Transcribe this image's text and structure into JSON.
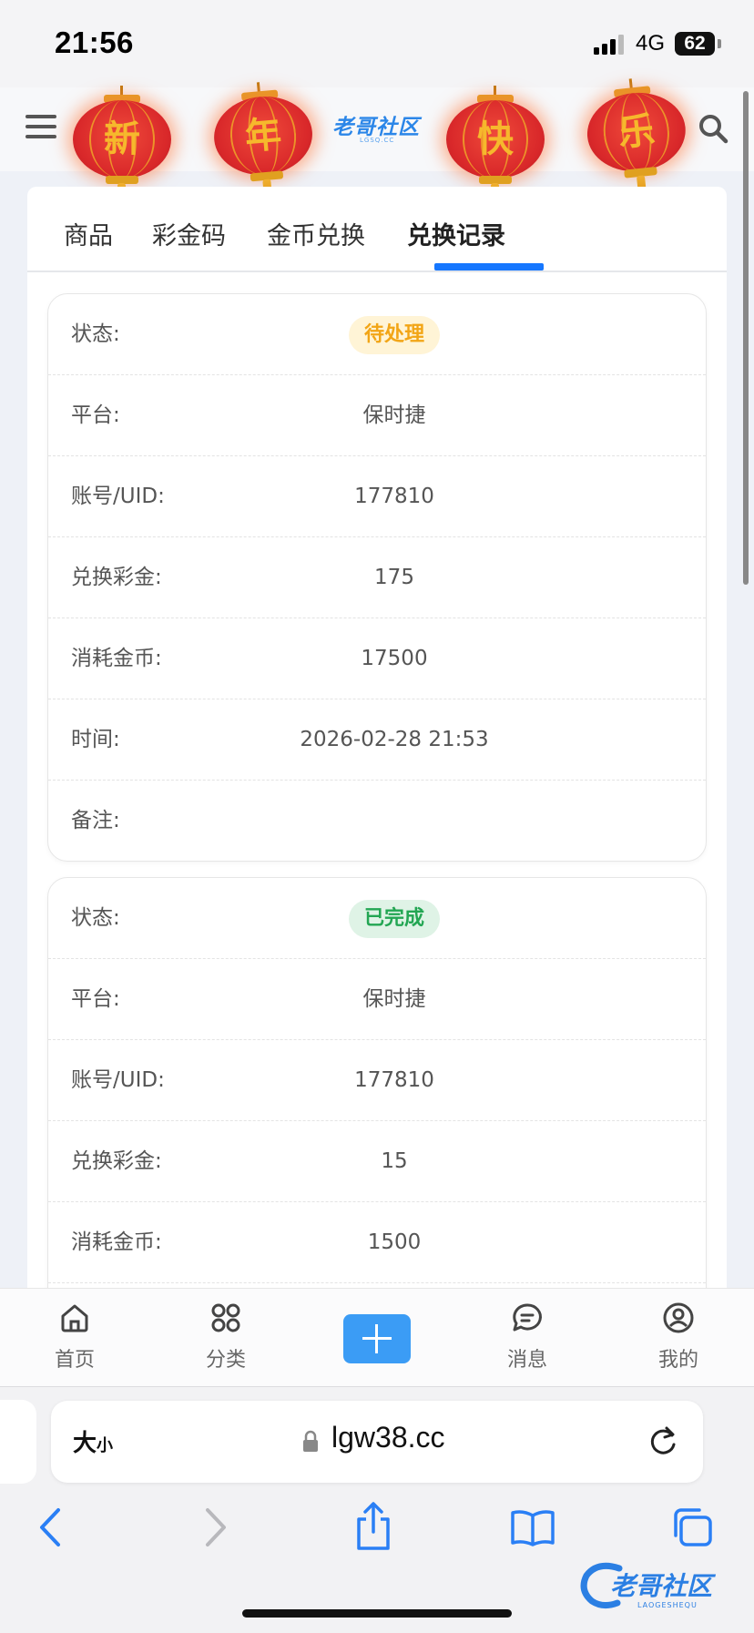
{
  "status_bar": {
    "time": "21:56",
    "network": "4G",
    "battery": "62"
  },
  "header": {
    "logo_text": "老哥社区",
    "logo_sub": "LGSQ.CC",
    "lanterns": [
      "新",
      "年",
      "快",
      "乐"
    ]
  },
  "tabs": [
    {
      "label": "商品",
      "active": false
    },
    {
      "label": "彩金码",
      "active": false
    },
    {
      "label": "金币兑换",
      "active": false
    },
    {
      "label": "兑换记录",
      "active": true
    }
  ],
  "records": [
    {
      "status_label": "状态:",
      "status": "待处理",
      "status_color": "#f2a516",
      "platform_label": "平台:",
      "platform": "保时捷",
      "uid_label": "账号/UID:",
      "uid": "177810",
      "bonus_label": "兑换彩金:",
      "bonus": "175",
      "coins_label": "消耗金币:",
      "coins": "17500",
      "time_label": "时间:",
      "time": "2026-02-28 21:53",
      "note_label": "备注:",
      "note": ""
    },
    {
      "status_label": "状态:",
      "status": "已完成",
      "status_color": "#23a653",
      "platform_label": "平台:",
      "platform": "保时捷",
      "uid_label": "账号/UID:",
      "uid": "177810",
      "bonus_label": "兑换彩金:",
      "bonus": "15",
      "coins_label": "消耗金币:",
      "coins": "1500"
    }
  ],
  "bottom_nav": [
    {
      "label": "首页",
      "icon": "home-icon"
    },
    {
      "label": "分类",
      "icon": "grid-icon"
    },
    {
      "label": "",
      "icon": "plus-icon"
    },
    {
      "label": "消息",
      "icon": "message-icon"
    },
    {
      "label": "我的",
      "icon": "user-icon"
    }
  ],
  "browser": {
    "text_size_big": "大",
    "text_size_small": "小",
    "url": "lgw38.cc"
  },
  "watermark": {
    "text": "老哥社区",
    "sub": "LAOGESHEQU"
  }
}
